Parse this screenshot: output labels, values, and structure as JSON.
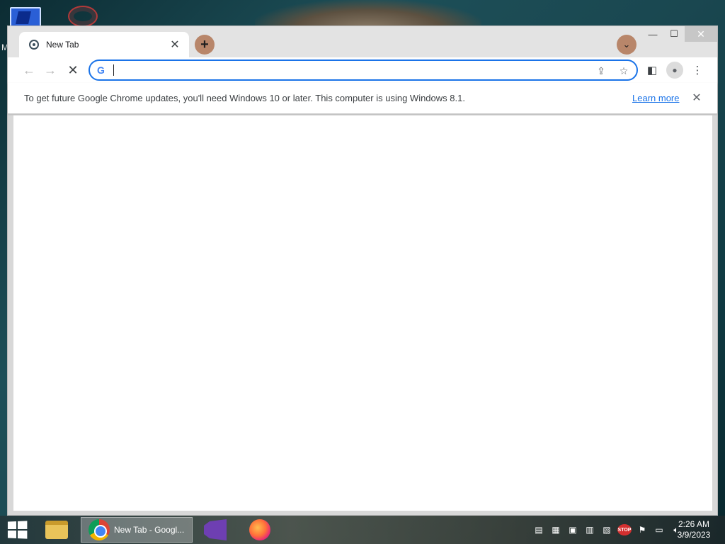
{
  "desktop": {
    "partial_letter": "M"
  },
  "browser": {
    "tab": {
      "title": "New Tab"
    },
    "window_controls": {
      "minimize": "—",
      "maximize": "☐",
      "close": "✕"
    },
    "toolbar": {
      "back": "←",
      "forward": "→",
      "stop": "✕",
      "omnibox_value": "",
      "google_glyph": "G"
    },
    "infobar": {
      "message": "To get future Google Chrome updates, you'll need Windows 10 or later. This computer is using Windows 8.1.",
      "learn_more": "Learn more"
    }
  },
  "taskbar": {
    "apps": [
      {
        "name": "file-explorer"
      },
      {
        "name": "chrome",
        "label": "New Tab - Googl..."
      },
      {
        "name": "visual-studio"
      },
      {
        "name": "firefox"
      }
    ],
    "tray": {
      "stop_badge": "STOP"
    },
    "clock": {
      "time": "2:26 AM",
      "date": "3/9/2023"
    }
  },
  "colors": {
    "accent": "#1a73e8",
    "tab_button_bg": "#b8866a"
  }
}
